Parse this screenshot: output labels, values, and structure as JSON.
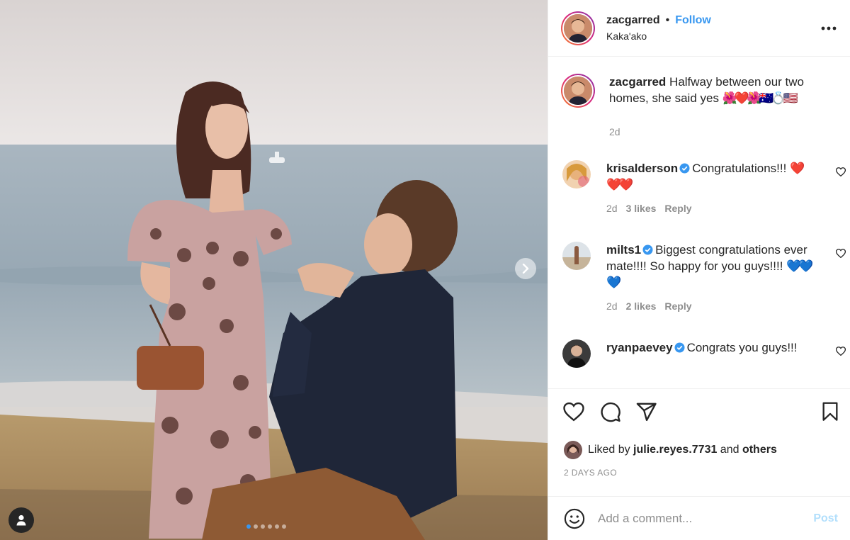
{
  "post": {
    "author": {
      "username": "zacgarred",
      "follow_label": "Follow",
      "separator": "•",
      "location": "Kaka'ako",
      "more_icon": "more-horizontal-icon"
    },
    "caption": {
      "username": "zacgarred",
      "text": " Halfway between our two homes, she said yes ",
      "emoji": "🌺❤️🌺🇦🇺💍🇺🇸",
      "time": "2d"
    },
    "carousel": {
      "slide_count": 6,
      "active_index": 0
    },
    "comments": [
      {
        "username": "krisalderson",
        "verified": true,
        "text": "Congratulations!!! ",
        "emoji": "❤️❤️❤️",
        "time": "2d",
        "likes": "3 likes",
        "reply_label": "Reply"
      },
      {
        "username": "milts1",
        "verified": true,
        "text": "Biggest congratulations ever mate!!!! So happy for you guys!!!! ",
        "emoji": "💙💙💙",
        "time": "2d",
        "likes": "2 likes",
        "reply_label": "Reply"
      },
      {
        "username": "ryanpaevey",
        "verified": true,
        "text": "Congrats you guys!!!"
      }
    ],
    "actions": {
      "icons": [
        "heart-icon",
        "comment-icon",
        "share-icon",
        "bookmark-icon"
      ]
    },
    "liked_by": {
      "prefix": "Liked by ",
      "username": "julie.reyes.7731",
      "middle": " and ",
      "others": "others"
    },
    "posted_ago": "2 DAYS AGO",
    "add_comment": {
      "placeholder": "Add a comment...",
      "post_label": "Post"
    },
    "colors": {
      "link_blue": "#3897f0",
      "muted_gray": "#8e8e8e",
      "text": "#262626",
      "post_disabled": "#b2dffc"
    }
  }
}
